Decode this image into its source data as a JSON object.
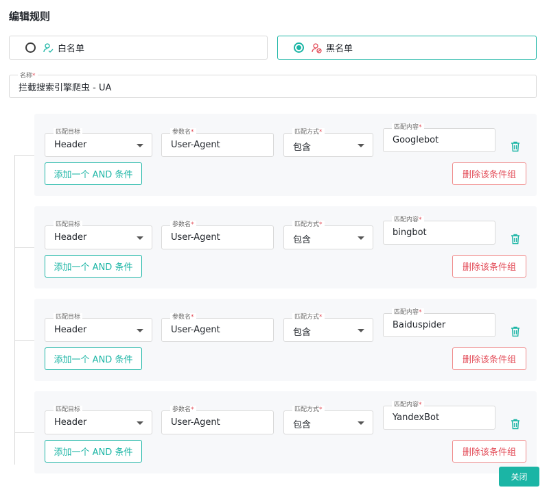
{
  "dialog": {
    "title": "编辑规则",
    "close_label": "关闭"
  },
  "modes": {
    "white": {
      "label": "白名单",
      "selected": false,
      "icon": "user-check-icon"
    },
    "black": {
      "label": "黑名单",
      "selected": true,
      "icon": "user-block-icon"
    }
  },
  "name": {
    "label": "名称",
    "required_mark": "*",
    "value": "拦截搜索引擎爬虫 - UA"
  },
  "labels": {
    "target": "匹配目标",
    "param": "参数名",
    "match": "匹配方式",
    "content": "匹配内容",
    "required_mark": "*",
    "add_and": "添加一个 AND 条件",
    "delete_group": "删除该条件组"
  },
  "groups": [
    {
      "target": "Header",
      "param": "User-Agent",
      "match": "包含",
      "content": "Googlebot"
    },
    {
      "target": "Header",
      "param": "User-Agent",
      "match": "包含",
      "content": "bingbot"
    },
    {
      "target": "Header",
      "param": "User-Agent",
      "match": "包含",
      "content": "Baiduspider"
    },
    {
      "target": "Header",
      "param": "User-Agent",
      "match": "包含",
      "content": "YandexBot"
    }
  ],
  "colors": {
    "accent": "#1bb5a5",
    "danger": "#e34d59"
  }
}
